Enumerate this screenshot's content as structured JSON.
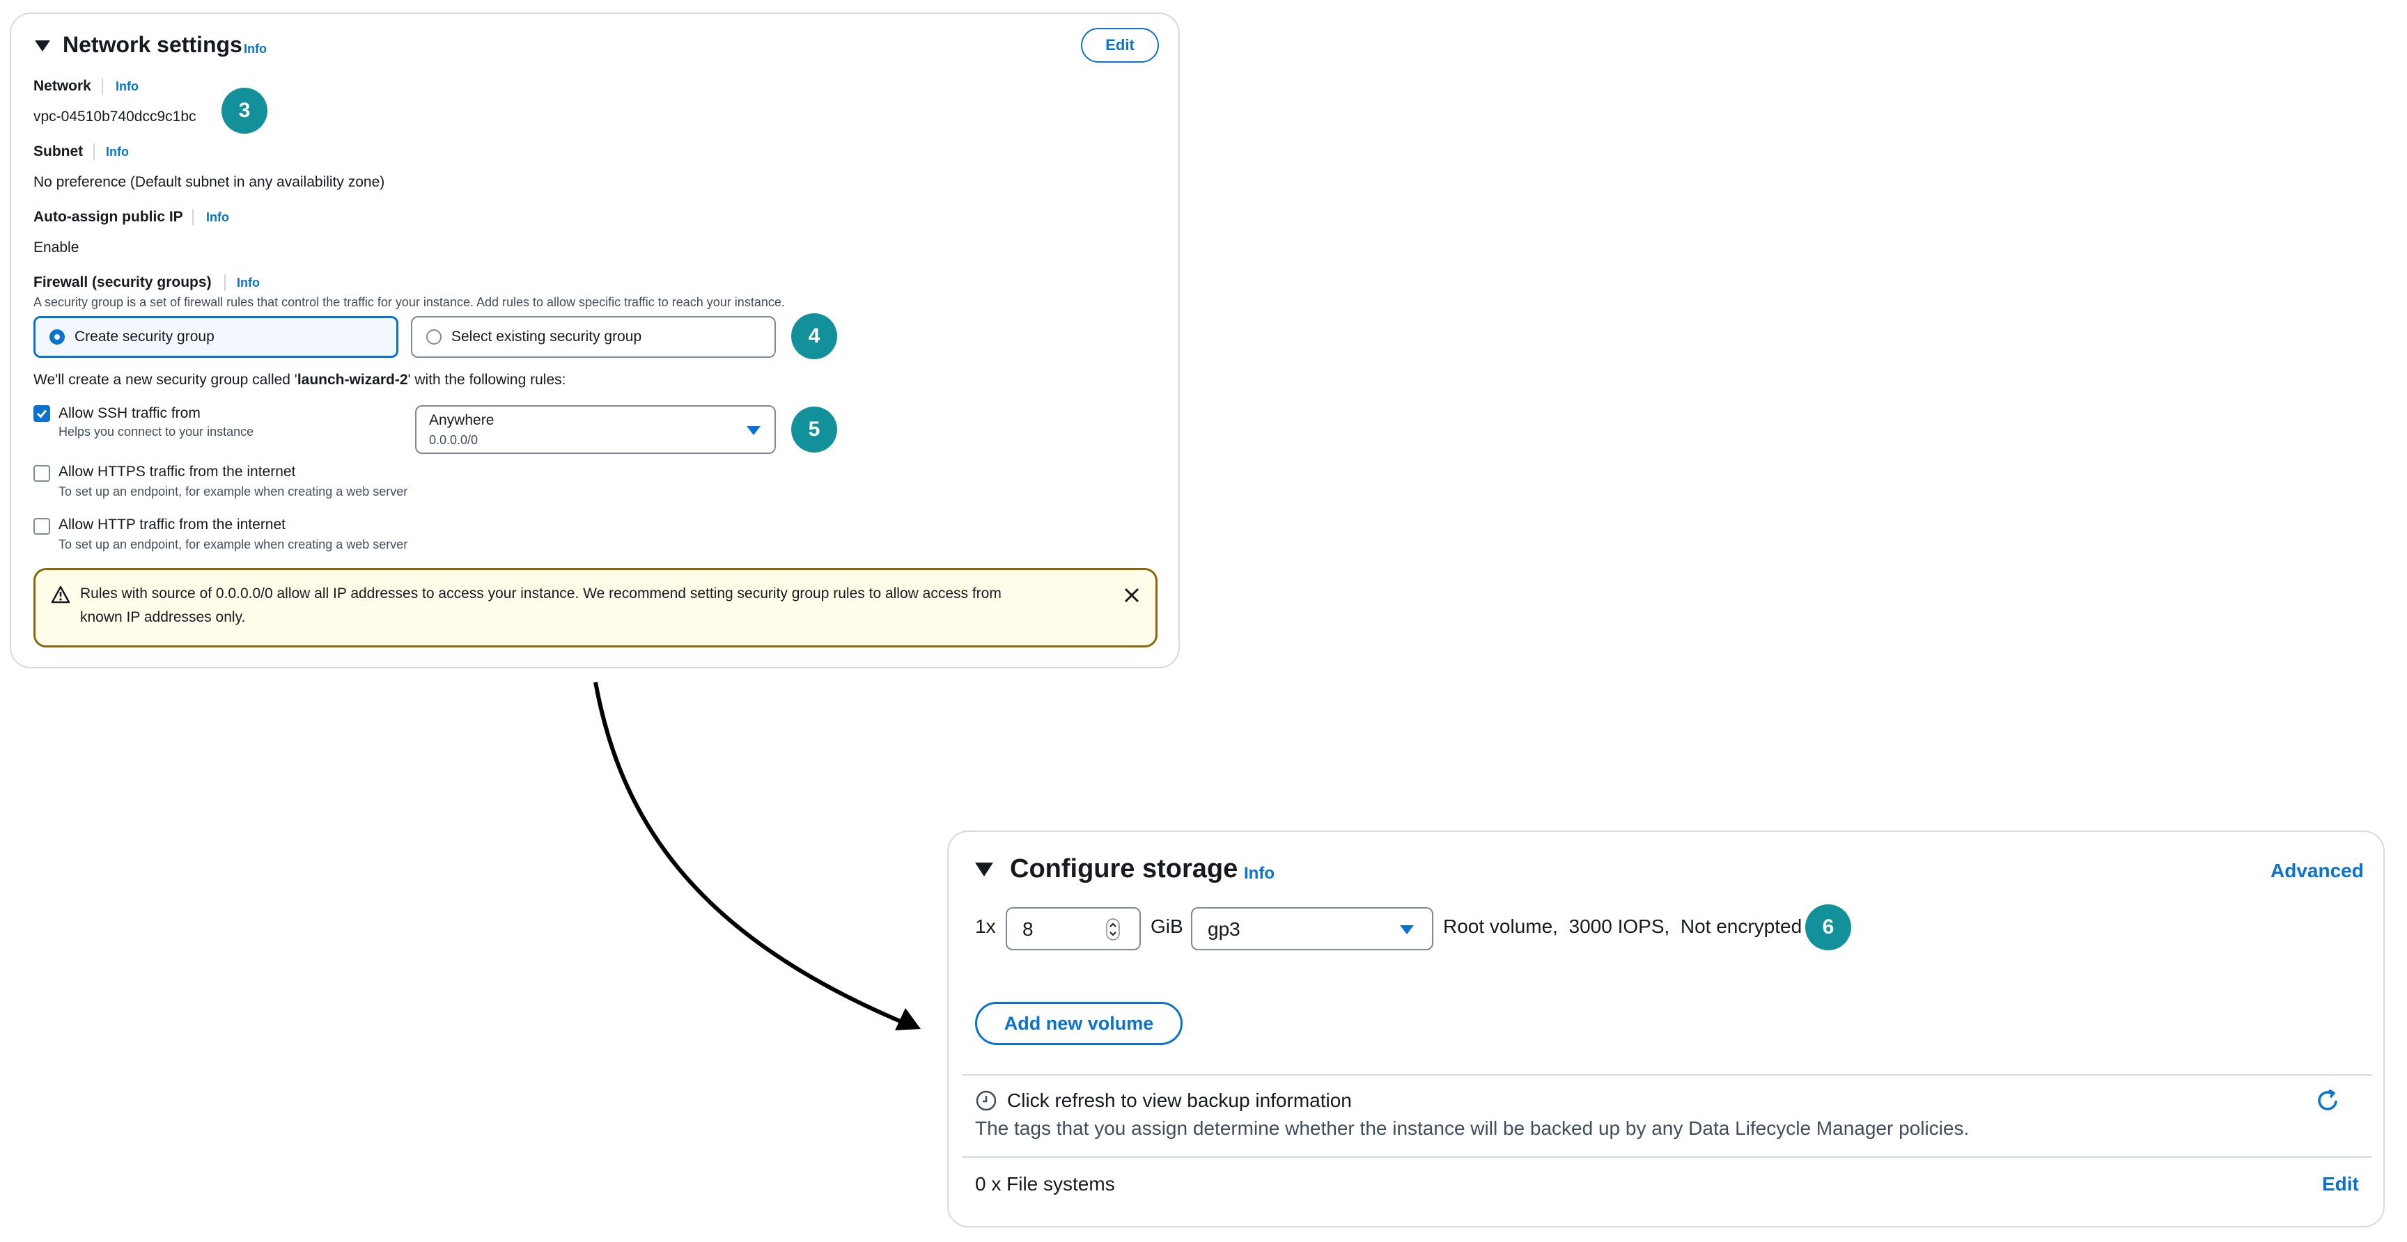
{
  "network": {
    "title": "Network settings",
    "info": "Info",
    "edit": "Edit",
    "network_label": "Network",
    "network_value": "vpc-04510b740dcc9c1bc",
    "subnet_label": "Subnet",
    "subnet_value": "No preference (Default subnet in any availability zone)",
    "public_ip_label": "Auto-assign public IP",
    "public_ip_value": "Enable",
    "firewall_label": "Firewall (security groups)",
    "firewall_desc": "A security group is a set of firewall rules that control the traffic for your instance. Add rules to allow specific traffic to reach your instance.",
    "option_create": "Create security group",
    "option_existing": "Select existing security group",
    "create_note_prefix": "We'll create a new security group called '",
    "create_note_name": "launch-wizard-2",
    "create_note_suffix": "' with the following rules:",
    "ssh_label": "Allow SSH traffic from",
    "ssh_desc": "Helps you connect to your instance",
    "ssh_source": "Anywhere",
    "ssh_source_cidr": "0.0.0.0/0",
    "https_label": "Allow HTTPS traffic from the internet",
    "https_desc": "To set up an endpoint, for example when creating a web server",
    "http_label": "Allow HTTP traffic from the internet",
    "http_desc": "To set up an endpoint, for example when creating a web server",
    "warning_line1": "Rules with source of 0.0.0.0/0 allow all IP addresses to access your instance. We recommend setting security group rules to allow access from",
    "warning_line2": "known IP addresses only."
  },
  "storage": {
    "title": "Configure storage",
    "info": "Info",
    "advanced": "Advanced",
    "count": "1x",
    "size": "8",
    "unit": "GiB",
    "volume_type": "gp3",
    "detail_root": "Root volume,",
    "detail_iops": "3000 IOPS,",
    "detail_enc": "Not encrypted",
    "add_volume": "Add new volume",
    "backup_title": "Click refresh to view backup information",
    "backup_desc": "The tags that you assign determine whether the instance will be backed up by any Data Lifecycle Manager policies.",
    "fs_label": "0 x File systems",
    "fs_edit": "Edit"
  },
  "badges": [
    "3",
    "4",
    "5",
    "6"
  ],
  "colors": {
    "accent": "#0972d3",
    "badge": "#13919b",
    "warning_border": "#8d6605",
    "warning_bg": "#fffce9",
    "tile_selected_bg": "#f2f8fd"
  }
}
